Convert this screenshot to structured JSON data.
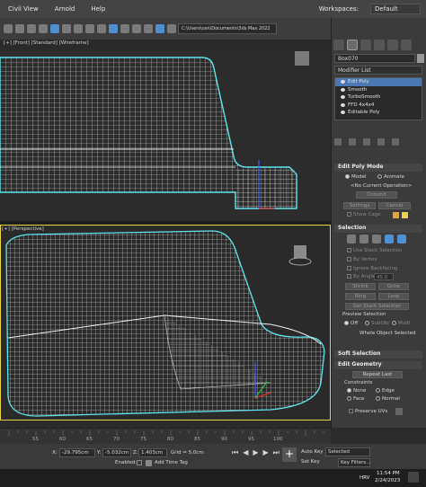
{
  "menubar": {
    "items": [
      "Civil View",
      "Arnold",
      "Help"
    ],
    "workspace_label": "Workspaces:",
    "workspace_value": "Default"
  },
  "toolbar": {
    "path": "C:\\Users\\cen\\Documents\\3ds Max 2022"
  },
  "viewports": {
    "top_label": "[+] [Front] [Standard] [Wireframe]",
    "persp_label": "[+] [Perspective]"
  },
  "command_panel": {
    "object_name": "Box070",
    "modifier_list": "Modifier List",
    "stack": [
      "Edit Poly",
      "Smooth",
      "TurboSmooth",
      "FFD 4x4x4",
      "Editable Poly"
    ],
    "edit_poly_mode": {
      "title": "Edit Poly Mode",
      "model": "Model",
      "animate": "Animate",
      "current_op": "<No Current Operation>",
      "commit": "Commit",
      "settings": "Settings",
      "cancel": "Cancel",
      "show_cage": "Show Cage"
    },
    "selection": {
      "title": "Selection",
      "use_stack": "Use Stack Selection",
      "by_vertex": "By Vertex",
      "ignore_backfacing": "Ignore Backfacing",
      "by_angle": "By Angle:",
      "angle_value": "45.0",
      "shrink": "Shrink",
      "grow": "Grow",
      "ring": "Ring",
      "loop": "Loop",
      "get_stack": "Get Stack Selection",
      "preview_title": "Preview Selection",
      "preview_off": "Off",
      "preview_subobj": "SubObj",
      "preview_multi": "Multi",
      "whole_selected": "Whole Object Selected"
    },
    "soft_selection": "Soft Selection",
    "edit_geometry": {
      "title": "Edit Geometry",
      "repeat_last": "Repeat Last",
      "constraints": "Constraints",
      "none": "None",
      "edge": "Edge",
      "face": "Face",
      "normal": "Normal",
      "preserve_uvs": "Preserve UVs"
    },
    "colors": {
      "swatch_orange": "#e8a33a",
      "swatch_yellow": "#ead54a",
      "selected_row": "#4b78b5"
    }
  },
  "timeline": {
    "ticks": [
      "55",
      "60",
      "65",
      "70",
      "75",
      "80",
      "85",
      "90",
      "95",
      "100"
    ]
  },
  "status": {
    "x_label": "X:",
    "x_value": "-29.795cm",
    "y_label": "Y:",
    "y_value": "-5.032cm",
    "z_label": "Z:",
    "z_value": "1.403cm",
    "grid": "Grid = 5.0cm",
    "enabled": "Enabled:",
    "add_time_tag": "Add Time Tag",
    "auto_key": "Auto Key",
    "set_key": "Set Key",
    "selected": "Selected",
    "key_filters": "Key Filters..."
  },
  "taskbar": {
    "lang": "HRV",
    "time": "11:54 PM",
    "date": "2/24/2023"
  }
}
